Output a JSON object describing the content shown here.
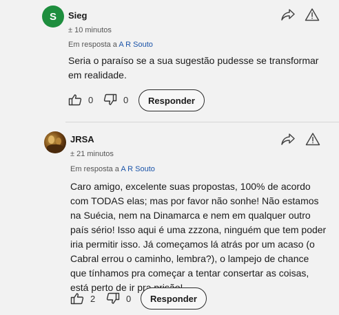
{
  "comments": [
    {
      "author": "Sieg",
      "avatar_letter": "S",
      "avatar_color": "#1e8e3e",
      "time": "± 10 minutos",
      "reply_prefix": "Em resposta a ",
      "reply_to": "A R Souto",
      "body": "Seria o paraíso se a sua sugestão pudesse se transformar em realidade.",
      "likes": "0",
      "dislikes": "0",
      "reply_label": "Responder"
    },
    {
      "author": "JRSA",
      "time": "± 21 minutos",
      "reply_prefix": "Em resposta a ",
      "reply_to": "A R Souto",
      "body": "Caro amigo, excelente suas propostas, 100% de acordo com TODAS elas; mas por favor não sonhe! Não estamos na Suécia, nem na Dinamarca e nem em qualquer outro país sério! Isso aqui é uma zzzona, ninguém que tem poder iria permitir isso. Já começamos lá atrás por um acaso (o Cabral errou o caminho, lembra?), o lampejo de chance que tínhamos pra começar a tentar consertar as coisas, está perto de ir pra prisão!",
      "likes": "2",
      "dislikes": "0",
      "reply_label": "Responder"
    }
  ],
  "icons": {
    "share": "share-icon",
    "report": "warning-icon",
    "like": "thumbs-up-icon",
    "dislike": "thumbs-down-icon"
  },
  "colors": {
    "background": "#f2f2f2",
    "link": "#1a53a8",
    "avatar_green": "#1e8e3e"
  }
}
